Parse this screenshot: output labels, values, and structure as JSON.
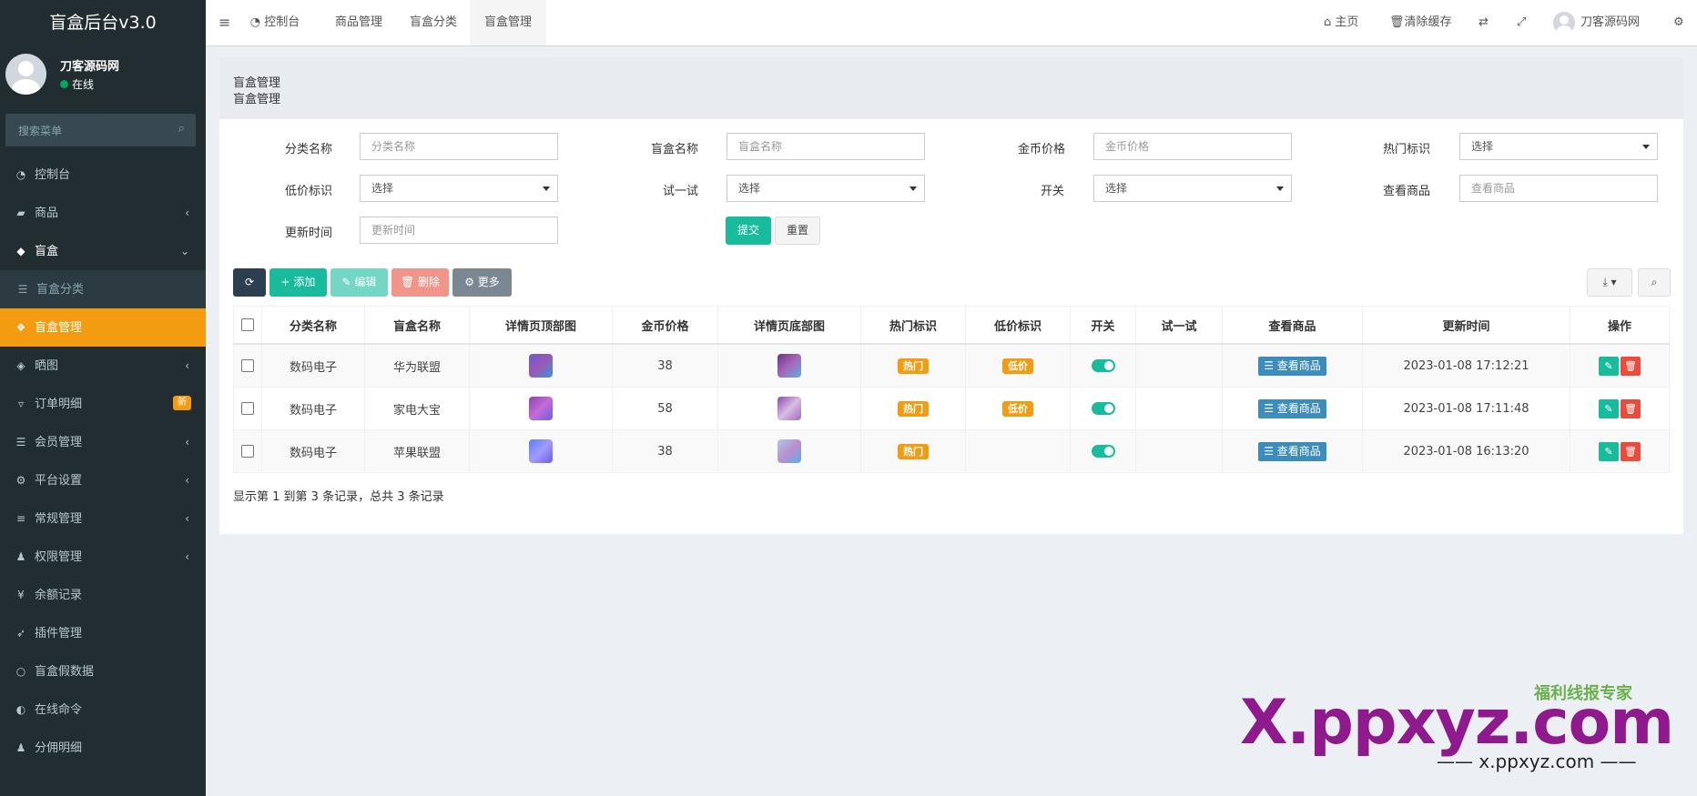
{
  "sidebar": {
    "logo": "盲盒后台v3.0",
    "username": "刀客源码网",
    "status": "在线",
    "search_placeholder": "搜索菜单",
    "menu": [
      {
        "icon": "dashboard-icon",
        "glyph": "◔",
        "label": "控制台",
        "state": "",
        "arrow": ""
      },
      {
        "icon": "shop-icon",
        "glyph": "▰",
        "label": "商品",
        "state": "",
        "arrow": "‹"
      },
      {
        "icon": "cube-icon",
        "glyph": "◆",
        "label": "盲盒",
        "state": "open",
        "arrow": "⌄"
      },
      {
        "icon": "list-icon",
        "glyph": "☰",
        "label": "盲盒分类",
        "state": "sub",
        "arrow": ""
      },
      {
        "icon": "cubes-icon",
        "glyph": "❖",
        "label": "盲盒管理",
        "state": "active",
        "arrow": ""
      },
      {
        "icon": "dropbox-icon",
        "glyph": "◈",
        "label": "晒图",
        "state": "",
        "arrow": "‹"
      },
      {
        "icon": "cart-icon",
        "glyph": "▿",
        "label": "订单明细",
        "state": "",
        "arrow": "",
        "badge": "新"
      },
      {
        "icon": "list-icon",
        "glyph": "☰",
        "label": "会员管理",
        "state": "",
        "arrow": "‹"
      },
      {
        "icon": "gear-icon",
        "glyph": "⚙",
        "label": "平台设置",
        "state": "",
        "arrow": "‹"
      },
      {
        "icon": "database-icon",
        "glyph": "≡",
        "label": "常规管理",
        "state": "",
        "arrow": "‹"
      },
      {
        "icon": "group-icon",
        "glyph": "♟",
        "label": "权限管理",
        "state": "",
        "arrow": "‹"
      },
      {
        "icon": "yen-icon",
        "glyph": "¥",
        "label": "余额记录",
        "state": "",
        "arrow": ""
      },
      {
        "icon": "rocket-icon",
        "glyph": "➶",
        "label": "插件管理",
        "state": "",
        "arrow": ""
      },
      {
        "icon": "circle-icon",
        "glyph": "○",
        "label": "盲盒假数据",
        "state": "",
        "arrow": ""
      },
      {
        "icon": "adjust-icon",
        "glyph": "◐",
        "label": "在线命令",
        "state": "",
        "arrow": ""
      },
      {
        "icon": "group-icon",
        "glyph": "♟",
        "label": "分佣明细",
        "state": "",
        "arrow": ""
      }
    ]
  },
  "topbar": {
    "tabs": [
      "控制台",
      "商品管理",
      "盲盒分类",
      "盲盒管理"
    ],
    "home": "主页",
    "clear_cache": "清除缓存",
    "user": "刀客源码网"
  },
  "page": {
    "title": "盲盒管理",
    "subtitle": "盲盒管理"
  },
  "filters": {
    "category_label": "分类名称",
    "category_placeholder": "分类名称",
    "box_label": "盲盒名称",
    "box_placeholder": "盲盒名称",
    "price_label": "金币价格",
    "price_placeholder": "金币价格",
    "hot_label": "热门标识",
    "hot_value": "选择",
    "low_label": "低价标识",
    "low_value": "选择",
    "try_label": "试一试",
    "try_value": "选择",
    "switch_label": "开关",
    "switch_value": "选择",
    "goods_label": "查看商品",
    "goods_placeholder": "查看商品",
    "time_label": "更新时间",
    "time_placeholder": "更新时间",
    "submit": "提交",
    "reset": "重置"
  },
  "toolbar": {
    "add": "添加",
    "edit": "编辑",
    "delete": "删除",
    "more": "更多"
  },
  "table": {
    "headers": [
      "分类名称",
      "盲盒名称",
      "详情页顶部图",
      "金币价格",
      "详情页底部图",
      "热门标识",
      "低价标识",
      "开关",
      "试一试",
      "查看商品",
      "更新时间",
      "操作"
    ],
    "rows": [
      {
        "category": "数码电子",
        "name": "华为联盟",
        "price": "38",
        "hot": "热门",
        "low": "低价",
        "view": "查看商品",
        "time": "2023-01-08 17:12:21"
      },
      {
        "category": "数码电子",
        "name": "家电大宝",
        "price": "58",
        "hot": "热门",
        "low": "低价",
        "view": "查看商品",
        "time": "2023-01-08 17:11:48"
      },
      {
        "category": "数码电子",
        "name": "苹果联盟",
        "price": "38",
        "hot": "热门",
        "low": "",
        "view": "查看商品",
        "time": "2023-01-08 16:13:20"
      }
    ]
  },
  "pagination_info": "显示第 1 到第 3 条记录，总共 3 条记录",
  "watermark": {
    "main": "X.ppxyz.com",
    "sub": "—— x.ppxyz.com ——",
    "brand": "福利线报专家"
  },
  "colors": {
    "sidebar_bg": "#222d32",
    "active_menu": "#f39c12",
    "primary": "#18bc9c",
    "danger": "#e74c3c",
    "info": "#3c8dbc"
  }
}
